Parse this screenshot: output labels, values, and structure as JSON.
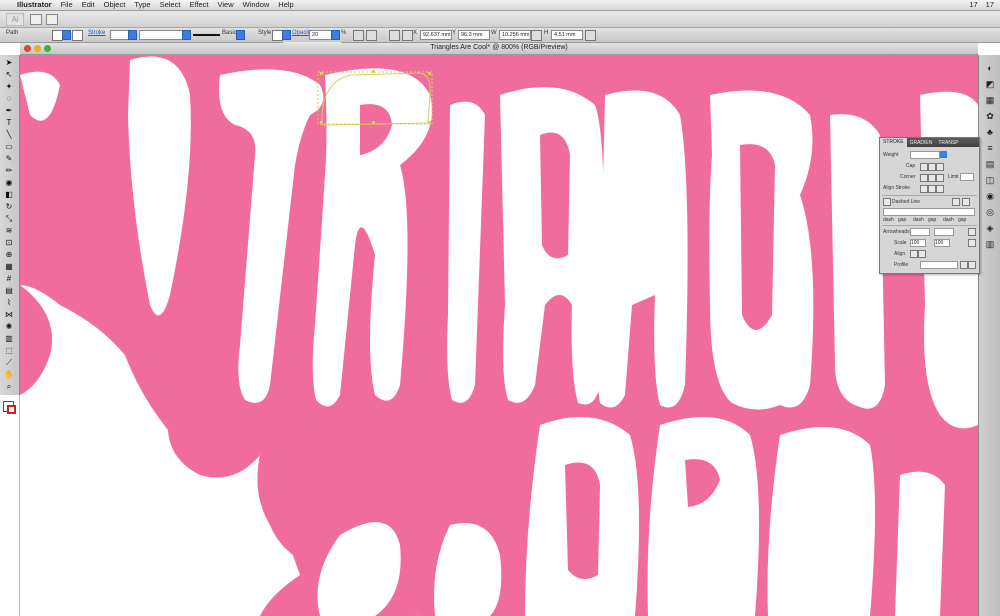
{
  "menubar": {
    "apple_glyph": "",
    "app_name": "Illustrator",
    "items": [
      "File",
      "Edit",
      "Object",
      "Type",
      "Select",
      "Effect",
      "View",
      "Window",
      "Help"
    ],
    "right": [
      "17",
      "17"
    ]
  },
  "appbar": {
    "logo": "Ai"
  },
  "control_bar": {
    "selection_label": "Path",
    "stroke_label": "Stroke",
    "stroke_size": "Basic",
    "style_label": "Style",
    "opacity_label": "Opacity",
    "opacity_value": "20",
    "percent": "%",
    "x_label": "X",
    "x_value": "92.637 mm",
    "y_label": "Y",
    "y_value": "96.3 mm",
    "w_label": "W",
    "w_value": "10.256 mm",
    "h_label": "H",
    "h_value": "4.51 mm"
  },
  "document": {
    "title": "Triangles Are Cool* @ 800% (RGB/Preview)",
    "window_buttons": {
      "close": "#e0443c",
      "minimize": "#e8b123",
      "zoom": "#3fb03c"
    },
    "colors": {
      "background": "#f06c9c",
      "letters": "#ffffff",
      "selection": "#d6cf61"
    }
  },
  "stroke_panel": {
    "tabs": [
      "STROKE",
      "GRADIEN",
      "TRANSP"
    ],
    "weight_label": "Weight",
    "cap_label": "Cap",
    "corner_label": "Corner",
    "limit_label": "Limit",
    "align_label": "Align Stroke",
    "dashed_line_label": "Dashed Line",
    "dash_labels": [
      "dash",
      "gap",
      "dash",
      "gap",
      "dash",
      "gap"
    ],
    "arrowheads_label": "Arrowheads",
    "scale_label": "Scale",
    "scale_values": [
      "100",
      "100"
    ],
    "align_arrows_label": "Align",
    "profile_label": "Profile"
  }
}
